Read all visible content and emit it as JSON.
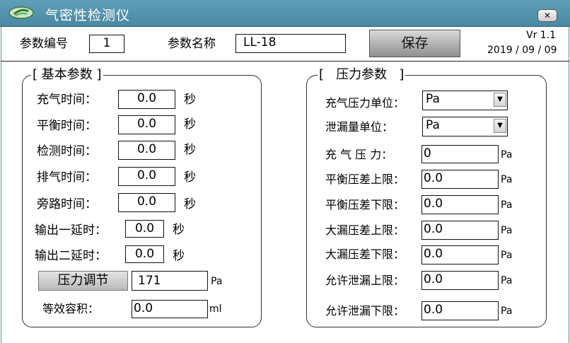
{
  "window": {
    "title": "气密性检测仪",
    "close_label": "✕"
  },
  "header": {
    "param_no_label": "参数编号",
    "param_no_value": "1",
    "param_name_label": "参数名称",
    "param_name_value": "LL-18",
    "save_label": "保存",
    "version": "Vr 1.1",
    "date": "2019 / 09 / 09"
  },
  "basic": {
    "title": "[ 基本参数 ]",
    "rows": [
      {
        "label": "充气时间：",
        "value": "0.0",
        "unit": "秒"
      },
      {
        "label": "平衡时间：",
        "value": "0.0",
        "unit": "秒"
      },
      {
        "label": "检测时间：",
        "value": "0.0",
        "unit": "秒"
      },
      {
        "label": "排气时间：",
        "value": "0.0",
        "unit": "秒"
      },
      {
        "label": "旁路时间：",
        "value": "0.0",
        "unit": "秒"
      }
    ],
    "delays": [
      {
        "label": "输出一延时：",
        "value": "0.0",
        "unit": "秒"
      },
      {
        "label": "输出二延时：",
        "value": "0.0",
        "unit": "秒"
      }
    ],
    "pressure_adjust_label": "压力调节",
    "pressure_adjust_value": "171",
    "pressure_adjust_unit": "Pa",
    "equiv_volume_label": "等效容积：",
    "equiv_volume_value": "0.0",
    "equiv_volume_unit": "ml"
  },
  "pressure": {
    "title": "[   压力参数   ]",
    "fill_unit_label": "充气压力单位：",
    "fill_unit_value": "Pa",
    "leak_unit_label": "泄漏量单位：",
    "leak_unit_value": "Pa",
    "rows": [
      {
        "label": "充 气 压 力：",
        "value": "0",
        "unit": "Pa"
      },
      {
        "label": "平衡压差上限：",
        "value": "0.0",
        "unit": "Pa"
      },
      {
        "label": "平衡压差下限：",
        "value": "0.0",
        "unit": "Pa"
      },
      {
        "label": "大漏压差上限：",
        "value": "0.0",
        "unit": "Pa"
      },
      {
        "label": "大漏压差下限：",
        "value": "0.0",
        "unit": "Pa"
      },
      {
        "label": "允许泄漏上限：",
        "value": "0.0",
        "unit": "Pa"
      },
      {
        "label": "允许泄漏下限：",
        "value": "0.0",
        "unit": "Pa"
      }
    ]
  },
  "colors": {
    "titlebar": "#4f8fab",
    "title_text": "#ffffff"
  }
}
